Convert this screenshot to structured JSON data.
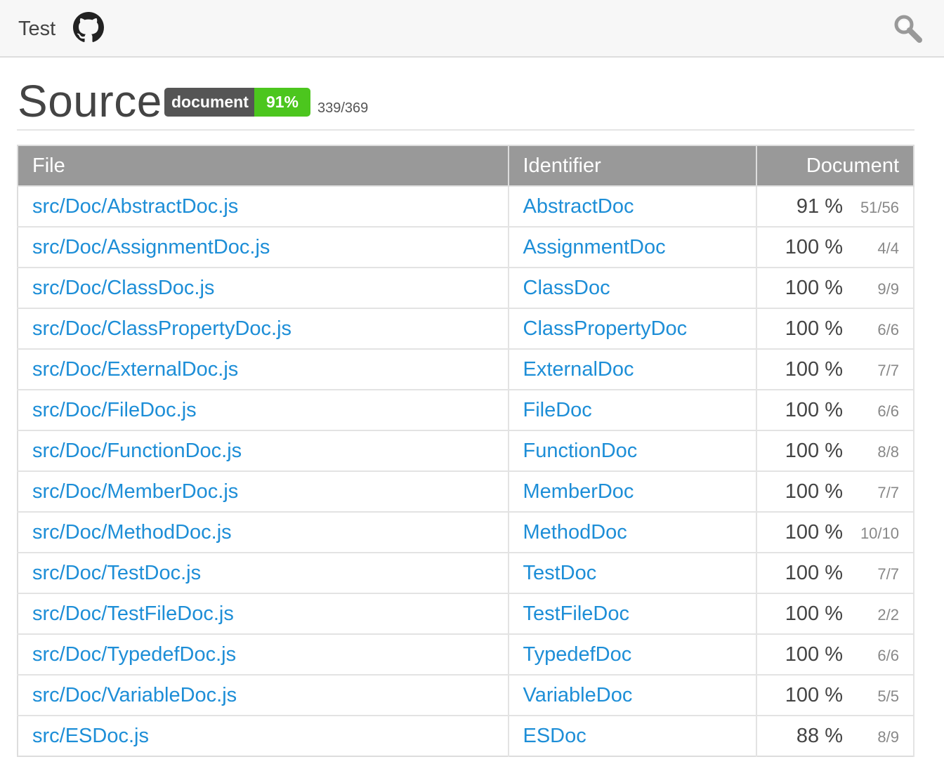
{
  "header": {
    "title": "Test",
    "github_icon": "github-icon",
    "search_icon": "search-icon"
  },
  "page": {
    "title": "Source",
    "badge": {
      "label": "document",
      "value": "91%",
      "label_color": "#555555",
      "value_color": "#4cc61e"
    },
    "coverage_count": "339/369"
  },
  "table": {
    "columns": [
      "File",
      "Identifier",
      "Document"
    ],
    "rows": [
      {
        "file": "src/Doc/AbstractDoc.js",
        "identifier": "AbstractDoc",
        "percent": "91 %",
        "count": "51/56"
      },
      {
        "file": "src/Doc/AssignmentDoc.js",
        "identifier": "AssignmentDoc",
        "percent": "100 %",
        "count": "4/4"
      },
      {
        "file": "src/Doc/ClassDoc.js",
        "identifier": "ClassDoc",
        "percent": "100 %",
        "count": "9/9"
      },
      {
        "file": "src/Doc/ClassPropertyDoc.js",
        "identifier": "ClassPropertyDoc",
        "percent": "100 %",
        "count": "6/6"
      },
      {
        "file": "src/Doc/ExternalDoc.js",
        "identifier": "ExternalDoc",
        "percent": "100 %",
        "count": "7/7"
      },
      {
        "file": "src/Doc/FileDoc.js",
        "identifier": "FileDoc",
        "percent": "100 %",
        "count": "6/6"
      },
      {
        "file": "src/Doc/FunctionDoc.js",
        "identifier": "FunctionDoc",
        "percent": "100 %",
        "count": "8/8"
      },
      {
        "file": "src/Doc/MemberDoc.js",
        "identifier": "MemberDoc",
        "percent": "100 %",
        "count": "7/7"
      },
      {
        "file": "src/Doc/MethodDoc.js",
        "identifier": "MethodDoc",
        "percent": "100 %",
        "count": "10/10"
      },
      {
        "file": "src/Doc/TestDoc.js",
        "identifier": "TestDoc",
        "percent": "100 %",
        "count": "7/7"
      },
      {
        "file": "src/Doc/TestFileDoc.js",
        "identifier": "TestFileDoc",
        "percent": "100 %",
        "count": "2/2"
      },
      {
        "file": "src/Doc/TypedefDoc.js",
        "identifier": "TypedefDoc",
        "percent": "100 %",
        "count": "6/6"
      },
      {
        "file": "src/Doc/VariableDoc.js",
        "identifier": "VariableDoc",
        "percent": "100 %",
        "count": "5/5"
      },
      {
        "file": "src/ESDoc.js",
        "identifier": "ESDoc",
        "percent": "88 %",
        "count": "8/9"
      }
    ]
  },
  "colors": {
    "link": "#1d8ed7",
    "header_bg": "#f7f7f7",
    "table_header_bg": "#999999"
  }
}
